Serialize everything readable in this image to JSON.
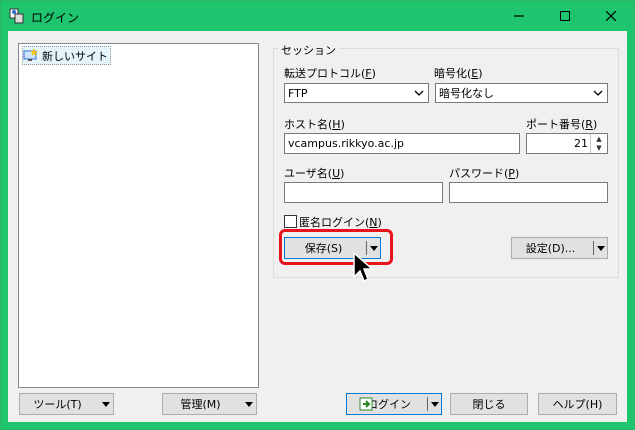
{
  "window": {
    "title": "ログイン",
    "accent_color": "#1fc46f",
    "controls": {
      "minimize": "minimize-icon",
      "maximize": "maximize-icon",
      "close": "close-icon"
    }
  },
  "site_tree": {
    "items": [
      {
        "label": "新しいサイト",
        "icon": "new-site-icon"
      }
    ]
  },
  "session": {
    "group_label": "セッション",
    "protocol": {
      "label": "転送プロトコル(",
      "key": "F",
      "suffix": ")",
      "value": "FTP"
    },
    "encryption": {
      "label": "暗号化(",
      "key": "E",
      "suffix": ")",
      "value": "暗号化なし"
    },
    "host": {
      "label": "ホスト名(",
      "key": "H",
      "suffix": ")",
      "value": "vcampus.rikkyo.ac.jp"
    },
    "port": {
      "label": "ポート番号(",
      "key": "R",
      "suffix": ")",
      "value": "21"
    },
    "user": {
      "label": "ユーザ名(",
      "key": "U",
      "suffix": ")",
      "value": ""
    },
    "password": {
      "label": "パスワード(",
      "key": "P",
      "suffix": ")",
      "value": ""
    },
    "anonymous": {
      "label": "匿名ログイン(",
      "key": "N",
      "suffix": ")",
      "checked": false
    },
    "save_button": "保存(S)",
    "settings_button": "設定(D)..."
  },
  "footer": {
    "tools_button": "ツール(T)",
    "manage_button": "管理(M)",
    "login_button": "ログイン",
    "close_button": "閉じる",
    "help_button": "ヘルプ(H)"
  },
  "highlight_color": "#e8141c"
}
